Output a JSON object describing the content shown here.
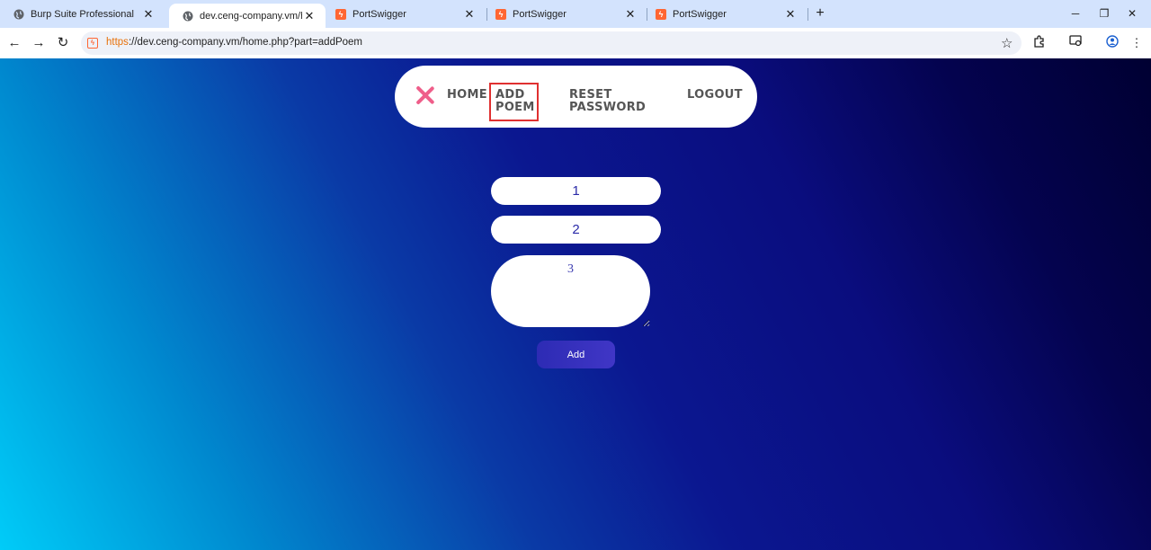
{
  "browser": {
    "tabs": [
      {
        "title": "Burp Suite Professional",
        "icon": "globe-icon"
      },
      {
        "title": "dev.ceng-company.vm/home.php?part=addPoem",
        "icon": "globe-icon",
        "active": true
      },
      {
        "title": "PortSwigger",
        "icon": "portswigger-icon"
      },
      {
        "title": "PortSwigger",
        "icon": "portswigger-icon"
      },
      {
        "title": "PortSwigger",
        "icon": "portswigger-icon"
      }
    ],
    "url_scheme": "https",
    "url_rest": "://dev.ceng-company.vm/home.php?part=addPoem"
  },
  "nav": {
    "home": "HOME",
    "add_poem": "ADD POEM",
    "reset_password": "RESET PASSWORD",
    "logout": "LOGOUT"
  },
  "form": {
    "field1_placeholder": "1",
    "field2_placeholder": "2",
    "poem_placeholder": "3",
    "submit_label": "Add"
  },
  "colors": {
    "accent_close": "#ef5e8a",
    "button": "#3430bd",
    "active_outline": "#e03030"
  }
}
